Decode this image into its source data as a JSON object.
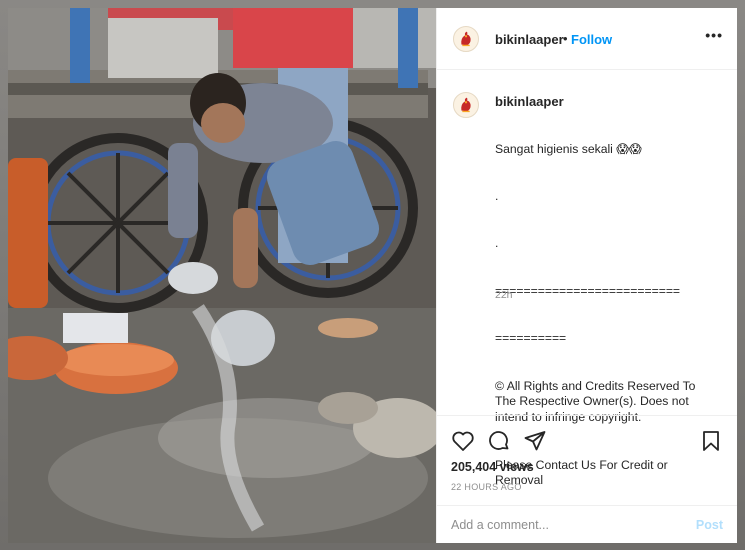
{
  "post": {
    "username": "bikinlaaper",
    "separator": "•",
    "follow_label": "Follow",
    "more_label": "•••",
    "caption_lines": [
      "Sangat higienis sekali 😱😱",
      ".",
      ".",
      "==========================",
      "==========",
      "© All Rights and Credits Reserved To The Respective Owner(s). Does not intend to infringe copyright.",
      "Please Contact Us For Credit or Removal"
    ],
    "caption_time": "22h",
    "views": "205,404 views",
    "posted_ago": "22 HOURS AGO"
  },
  "comment": {
    "placeholder": "Add a comment...",
    "post_label": "Post"
  },
  "icons": {
    "like": "heart-icon",
    "comment": "comment-icon",
    "share": "share-icon",
    "save": "bookmark-icon",
    "more": "more-options-icon"
  },
  "colors": {
    "accent": "#0095f6",
    "post_disabled": "#b2dffc",
    "muted": "#8e8e8e",
    "text": "#262626"
  }
}
